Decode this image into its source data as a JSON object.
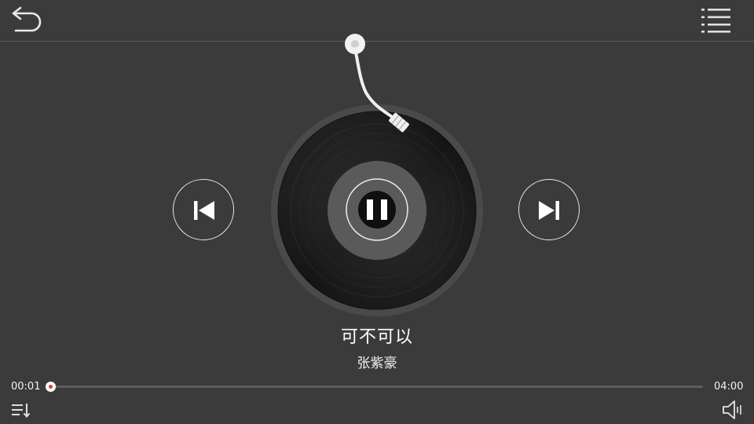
{
  "header": {
    "back_icon": "back-arrow-icon",
    "menu_icon": "list-menu-icon"
  },
  "player": {
    "song_title": "可不可以",
    "artist": "张紫豪",
    "state": "playing",
    "controls": {
      "prev_icon": "skip-previous-icon",
      "play_pause_icon": "pause-icon",
      "next_icon": "skip-next-icon"
    }
  },
  "progress": {
    "current_time": "00:01",
    "total_time": "04:00",
    "fraction": 0.004,
    "fill_color": "#d94040"
  },
  "footer": {
    "playlist_mode_icon": "playlist-order-icon",
    "volume_icon": "volume-icon"
  },
  "colors": {
    "background": "#3b3b3b",
    "accent": "#d8402f"
  }
}
